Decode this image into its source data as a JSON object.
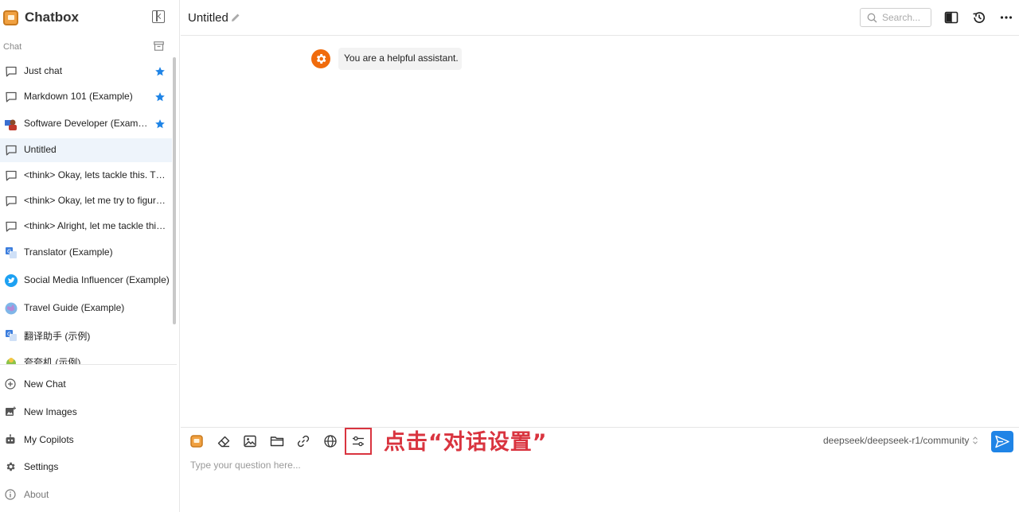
{
  "app": {
    "name": "Chatbox"
  },
  "sidebar": {
    "section_label": "Chat",
    "sessions": [
      {
        "label": "Just chat",
        "icon": "chat-bubble-icon",
        "starred": true,
        "active": false
      },
      {
        "label": "Markdown 101 (Example)",
        "icon": "chat-bubble-icon",
        "starred": true,
        "active": false
      },
      {
        "label": "Software Developer (Example)",
        "icon": "developer-avatar-icon",
        "starred": true,
        "active": false
      },
      {
        "label": "Untitled",
        "icon": "chat-bubble-icon",
        "starred": false,
        "active": true
      },
      {
        "label": "<think> Okay, lets tackle this. The user",
        "icon": "chat-bubble-icon",
        "starred": false,
        "active": false
      },
      {
        "label": "<think> Okay, let me try to figure out",
        "icon": "chat-bubble-icon",
        "starred": false,
        "active": false
      },
      {
        "label": "<think> Alright, let me tackle this. The",
        "icon": "chat-bubble-icon",
        "starred": false,
        "active": false
      },
      {
        "label": "Translator (Example)",
        "icon": "translator-avatar-icon",
        "starred": false,
        "active": false
      },
      {
        "label": "Social Media Influencer (Example)",
        "icon": "twitter-avatar-icon",
        "starred": false,
        "active": false
      },
      {
        "label": "Travel Guide (Example)",
        "icon": "globe-avatar-icon",
        "starred": false,
        "active": false
      },
      {
        "label": "翻译助手 (示例)",
        "icon": "translator-avatar-icon",
        "starred": false,
        "active": false
      },
      {
        "label": "夸夸机 (示例)",
        "icon": "cheer-avatar-icon",
        "starred": false,
        "active": false
      }
    ],
    "nav": {
      "new_chat": "New Chat",
      "new_images": "New Images",
      "my_copilots": "My Copilots",
      "settings": "Settings",
      "about": "About"
    }
  },
  "header": {
    "title": "Untitled",
    "search_placeholder": "Search..."
  },
  "messages": [
    {
      "role": "system",
      "text": "You are a helpful assistant."
    }
  ],
  "composer": {
    "annotation": "点击“对话设置”",
    "model": "deepseek/deepseek-r1/community",
    "placeholder": "Type your question here..."
  },
  "colors": {
    "accent": "#1f84e6",
    "active_session_bg": "#eef4fb",
    "annotation_red": "#d9343f",
    "system_avatar": "#f06b0c"
  }
}
